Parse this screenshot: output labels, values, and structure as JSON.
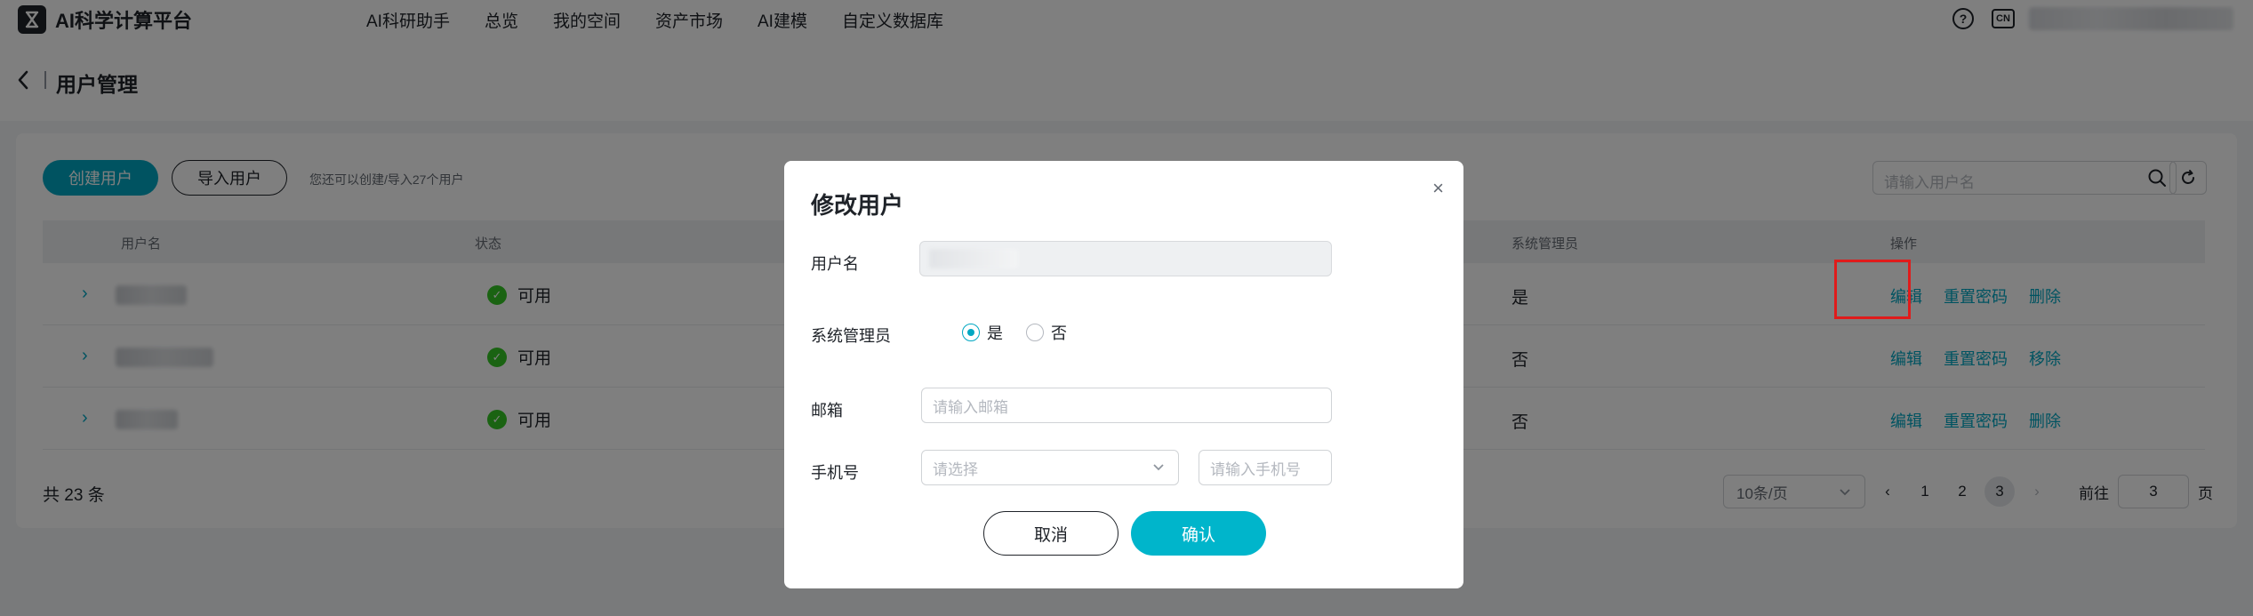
{
  "app": {
    "title": "AI科学计算平台"
  },
  "nav": {
    "items": [
      "AI科研助手",
      "总览",
      "我的空间",
      "资产市场",
      "AI建模",
      "自定义数据库"
    ]
  },
  "header": {
    "help_glyph": "?",
    "lang": "CN"
  },
  "page": {
    "title": "用户管理"
  },
  "toolbar": {
    "create_label": "创建用户",
    "import_label": "导入用户",
    "hint": "您还可以创建/导入27个用户",
    "search_placeholder": "请输入用户名"
  },
  "table": {
    "columns": {
      "username": "用户名",
      "status": "状态",
      "admin": "系统管理员",
      "actions": "操作"
    },
    "rows": [
      {
        "status": "可用",
        "admin": "是",
        "actions": [
          "编辑",
          "重置密码",
          "删除"
        ]
      },
      {
        "status": "可用",
        "admin": "否",
        "actions": [
          "编辑",
          "重置密码",
          "移除"
        ]
      },
      {
        "status": "可用",
        "admin": "否",
        "actions": [
          "编辑",
          "重置密码",
          "删除"
        ]
      }
    ]
  },
  "pagination": {
    "total": "共 23 条",
    "page_size": "10条/页",
    "pages": [
      "1",
      "2",
      "3"
    ],
    "current": "3",
    "goto_prefix": "前往",
    "goto_value": "3",
    "goto_suffix": "页"
  },
  "modal": {
    "title": "修改用户",
    "close": "×",
    "username_label": "用户名",
    "admin_label": "系统管理员",
    "admin_yes": "是",
    "admin_no": "否",
    "admin_selected": "是",
    "email_label": "邮箱",
    "email_placeholder": "请输入邮箱",
    "phone_label": "手机号",
    "country_placeholder": "请选择",
    "phone_placeholder": "请输入手机号",
    "cancel_label": "取消",
    "ok_label": "确认"
  },
  "colors": {
    "accent": "#00a7c2",
    "highlight": "#e01b1b",
    "success": "#34c724"
  }
}
